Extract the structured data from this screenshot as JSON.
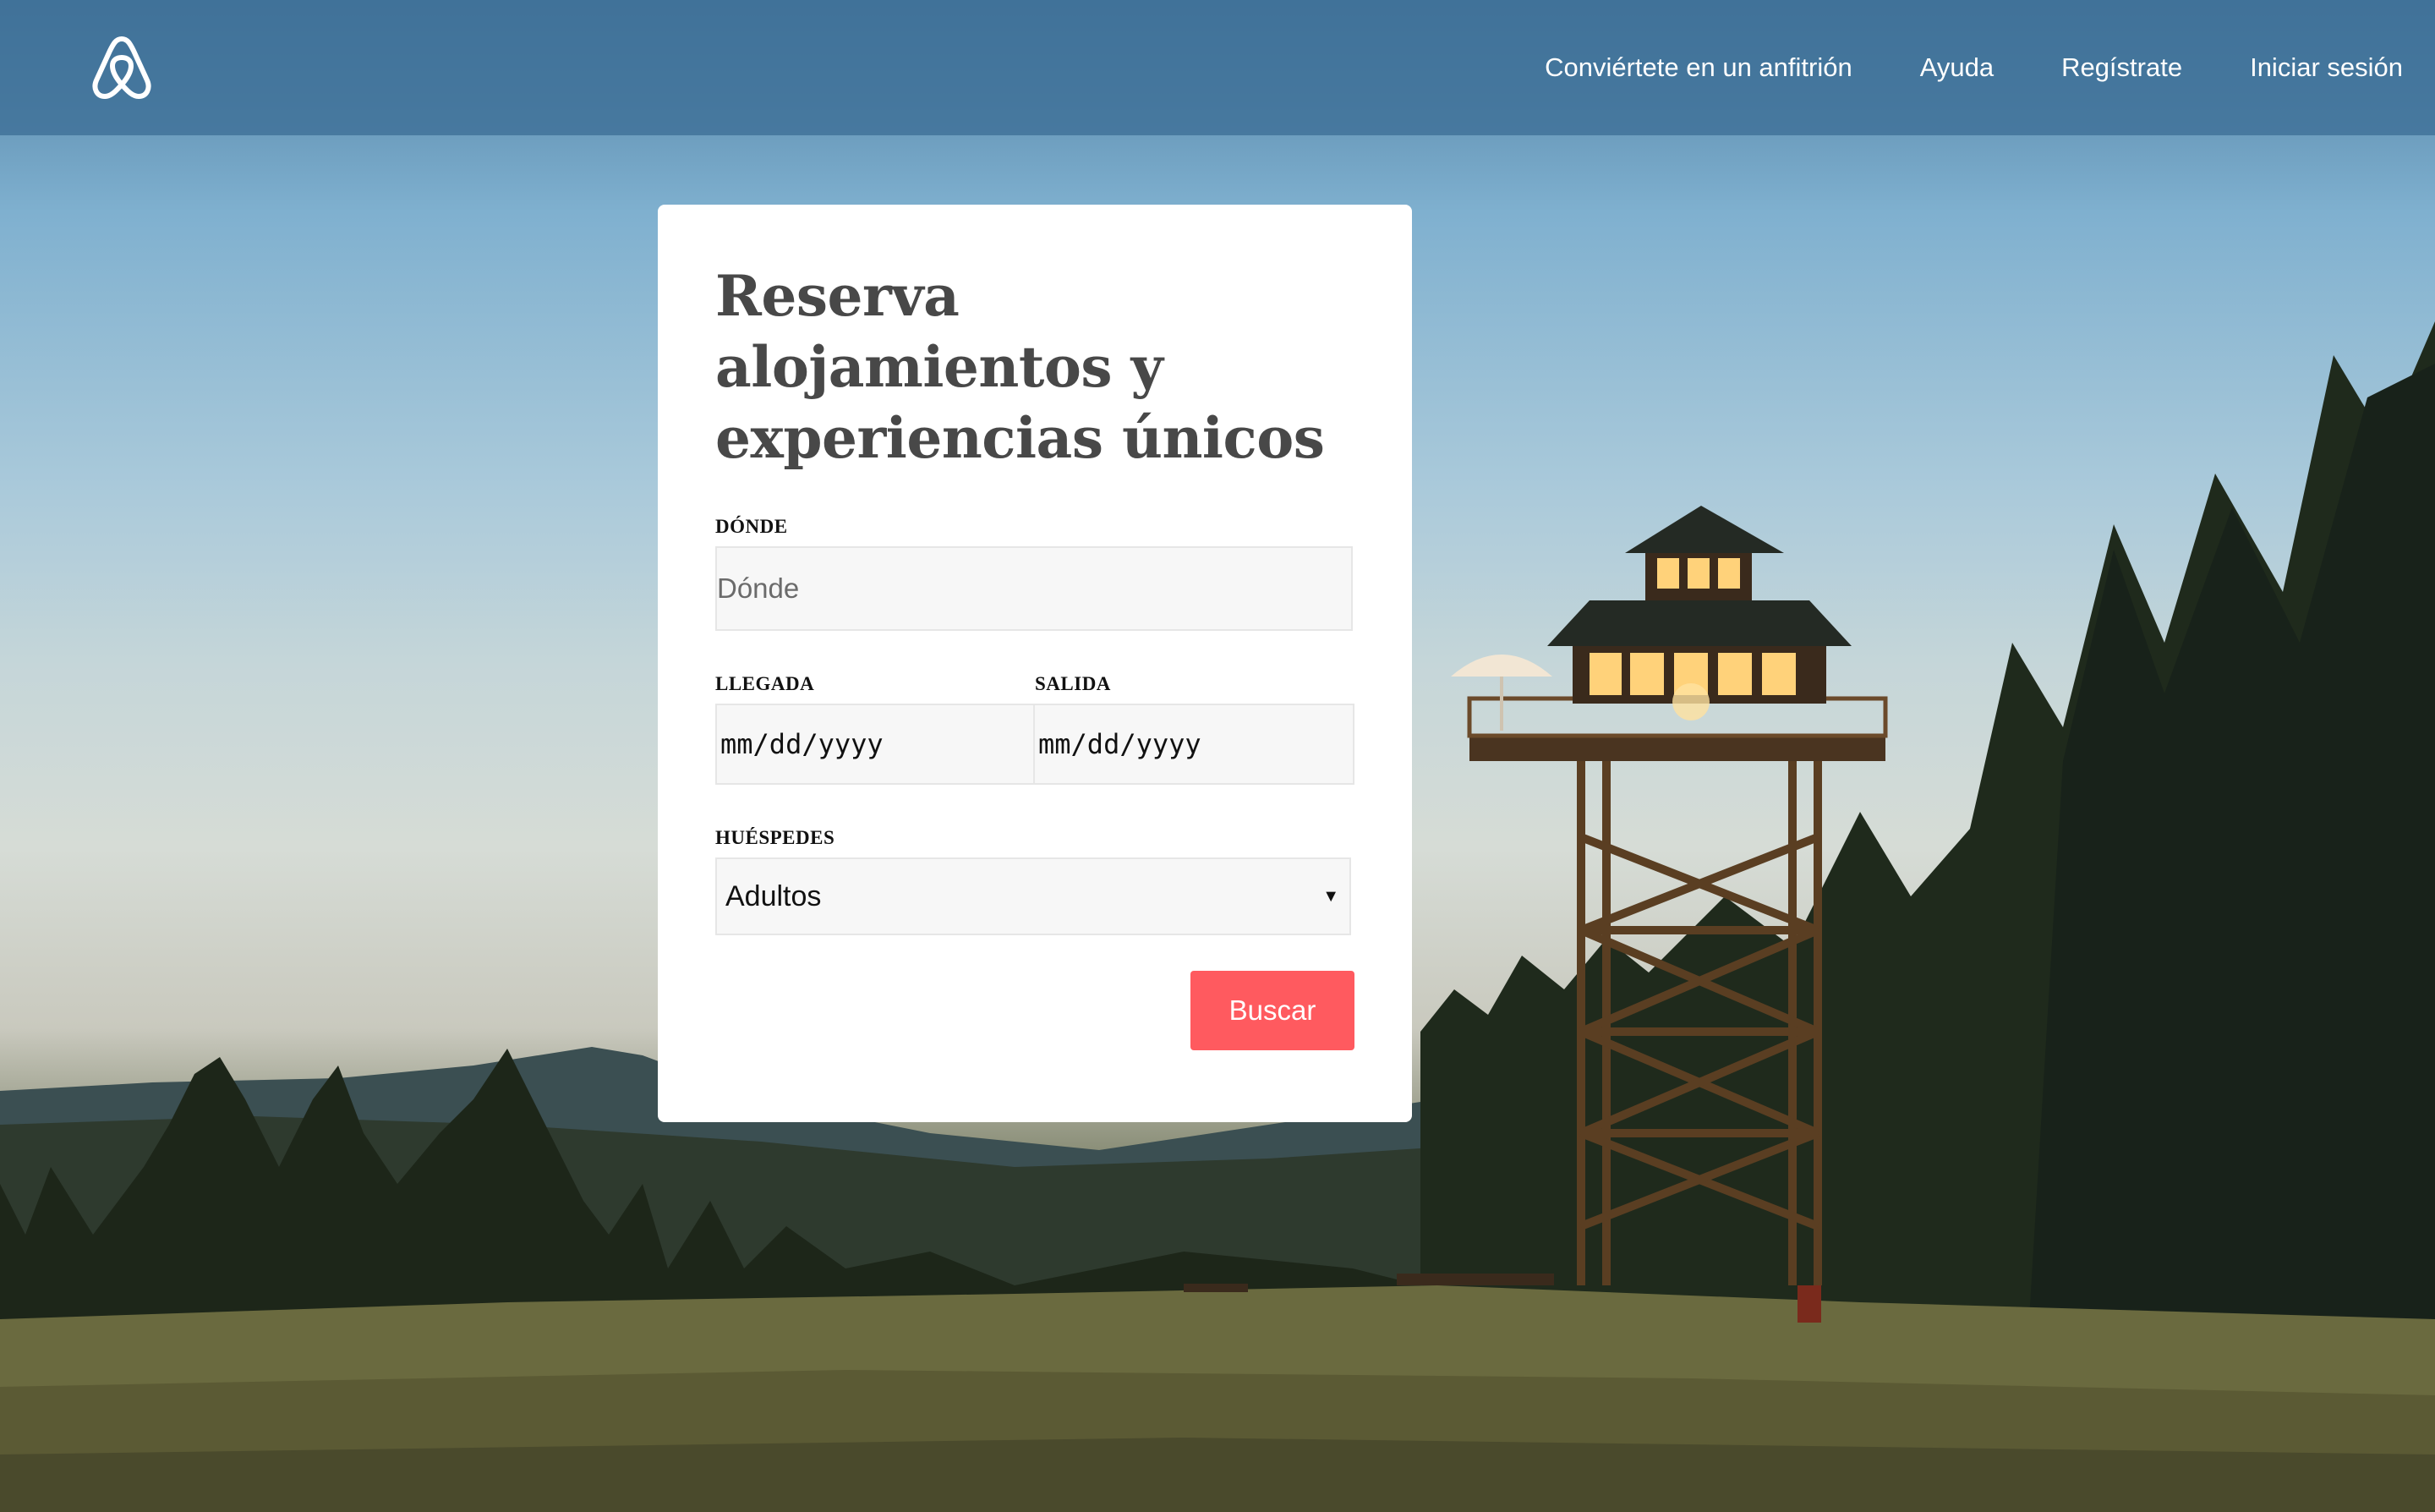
{
  "header": {
    "logo_icon": "airbnb-belo-icon",
    "nav": {
      "host": "Conviértete en un anfitrión",
      "help": "Ayuda",
      "signup": "Regístrate",
      "login": "Iniciar sesión"
    }
  },
  "search_card": {
    "title": "Reserva alojamientos y experiencias únicos",
    "where": {
      "label": "DÓNDE",
      "placeholder": "Dónde"
    },
    "checkin": {
      "label": "LLEGADA",
      "placeholder": "mm/dd/yyyy"
    },
    "checkout": {
      "label": "SALIDA",
      "placeholder": "mm/dd/yyyy"
    },
    "guests": {
      "label": "HUÉSPEDES",
      "selected": "Adultos"
    },
    "submit": "Buscar"
  },
  "colors": {
    "accent": "#ff5a5f",
    "header_overlay": "#3c6e96",
    "card_text": "#484848"
  }
}
